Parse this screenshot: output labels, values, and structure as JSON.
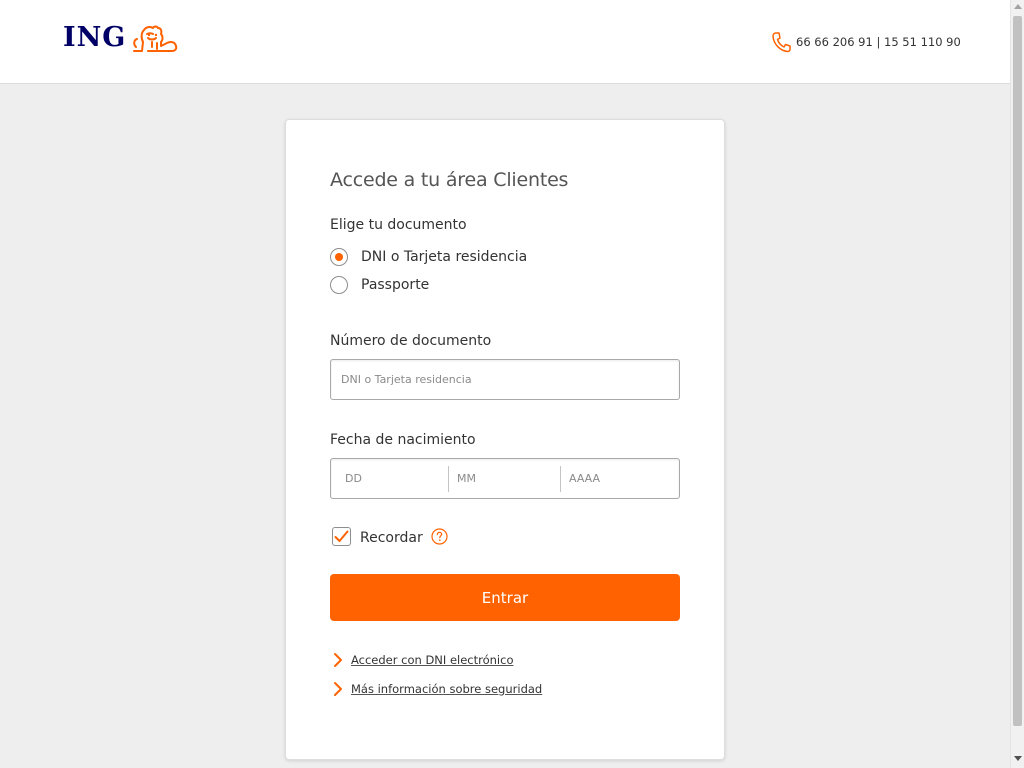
{
  "header": {
    "logo_text": "ING",
    "phone_text": "66 66 206 91 | 15 51 110 90"
  },
  "form": {
    "title": "Accede a tu área Clientes",
    "document_label": "Elige tu documento",
    "options": [
      {
        "label": "DNI o Tarjeta residencia",
        "selected": true
      },
      {
        "label": "Passporte",
        "selected": false
      }
    ],
    "doc_number_label": "Número de documento",
    "doc_number_placeholder": "DNI o Tarjeta residencia",
    "birthdate_label": "Fecha de nacimiento",
    "birthdate_placeholders": {
      "day": "DD",
      "month": "MM",
      "year": "AAAA"
    },
    "remember_label": "Recordar",
    "remember_checked": true,
    "submit_label": "Entrar",
    "links": [
      {
        "label": "Acceder con DNI electrónico"
      },
      {
        "label": "Más información sobre seguridad"
      }
    ]
  },
  "colors": {
    "accent": "#ff6200",
    "brand_blue": "#000066",
    "background": "#eeeeee"
  },
  "icons": {
    "logo": "lion-icon",
    "phone": "phone-icon",
    "help": "help-circle-icon",
    "check": "checkmark-icon",
    "link": "chevron-right-icon"
  }
}
